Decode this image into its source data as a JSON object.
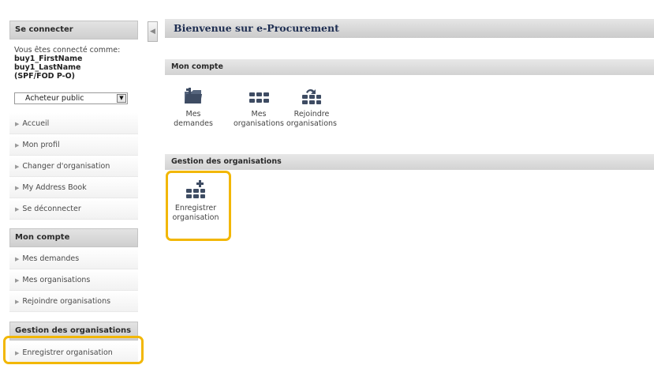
{
  "sidebar": {
    "login_header": "Se connecter",
    "connected_as": "Vous êtes connecté comme:",
    "first_name": "buy1_FirstName",
    "last_name": "buy1_LastName",
    "org": "(SPF/FOD P-O)",
    "role_select": {
      "value": "Acheteur public"
    },
    "nav_items": [
      {
        "label": "Accueil"
      },
      {
        "label": "Mon profil"
      },
      {
        "label": "Changer d'organisation"
      },
      {
        "label": "My Address Book"
      },
      {
        "label": "Se déconnecter"
      }
    ],
    "account_header": "Mon compte",
    "account_items": [
      {
        "label": "Mes demandes"
      },
      {
        "label": "Mes organisations"
      },
      {
        "label": "Rejoindre organisations"
      }
    ],
    "orgs_header": "Gestion des organisations",
    "orgs_items": [
      {
        "label": "Enregistrer organisation"
      }
    ]
  },
  "main": {
    "title": "Bienvenue sur e-Procurement",
    "account_section": {
      "header": "Mon compte",
      "tiles": [
        {
          "line1": "Mes",
          "line2": "demandes",
          "icon": "folder-icon"
        },
        {
          "line1": "Mes",
          "line2": "organisations",
          "icon": "organisations-icon"
        },
        {
          "line1": "Rejoindre",
          "line2": "organisations",
          "icon": "join-organisations-icon"
        }
      ]
    },
    "orgs_section": {
      "header": "Gestion des organisations",
      "tiles": [
        {
          "line1": "Enregistrer",
          "line2": "organisation",
          "icon": "register-organisation-icon"
        }
      ]
    }
  },
  "colors": {
    "highlight": "#f2b705",
    "icon": "#3e4c63",
    "title_text": "#1e2e52"
  }
}
